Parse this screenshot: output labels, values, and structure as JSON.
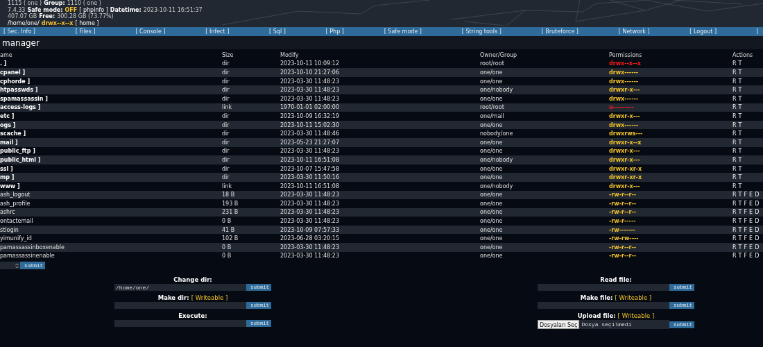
{
  "info": [
    [
      {
        "kind": "text",
        "text": "1115 ( one )"
      },
      {
        "kind": "label",
        "text": "Group:"
      },
      {
        "kind": "text",
        "text": "1110 ( one )"
      }
    ],
    [
      {
        "kind": "text",
        "text": "7.4.33"
      },
      {
        "kind": "label",
        "text": "Safe mode:"
      },
      {
        "kind": "status",
        "text": "OFF"
      },
      {
        "kind": "link",
        "text": "[ phpinfo ]"
      },
      {
        "kind": "label",
        "text": "Datetime:"
      },
      {
        "kind": "text",
        "text": "2023-10-11 16:51:37"
      }
    ],
    [
      {
        "kind": "text",
        "text": "407.07 GB"
      },
      {
        "kind": "label",
        "text": "Free:"
      },
      {
        "kind": "text",
        "text": "300.28 GB (73.77%)"
      }
    ],
    [
      {
        "kind": "link",
        "text": "/home/one/"
      },
      {
        "kind": "status",
        "text": "drwx--x--x"
      },
      {
        "kind": "link",
        "text": "[ home ]"
      }
    ]
  ],
  "menu": [
    "[ Sec. Info ]",
    "[ Files ]",
    "[ Console ]",
    "[ Infect ]",
    "[ Sql ]",
    "[ Php ]",
    "[ Safe mode ]",
    "[ String tools ]",
    "[ Bruteforce ]",
    "[ Network ]",
    "[ Logout ]",
    "["
  ],
  "section_title": "manager",
  "table": {
    "columns": [
      "ame",
      "Size",
      "Modify",
      "Owner/Group",
      "Permissions",
      "Actions"
    ],
    "rows": [
      {
        "kind": "dir",
        "name": ". ]",
        "size": "dir",
        "modify": "2023-10-11 10:09:12",
        "owner": "root/root",
        "perms": "drwx--x--x",
        "writable": false,
        "actions": [
          "R",
          "T"
        ]
      },
      {
        "kind": "dir",
        "name": "cpanel ]",
        "size": "dir",
        "modify": "2023-10-10 21:27:06",
        "owner": "one/one",
        "perms": "drwx------",
        "writable": true,
        "actions": [
          "R",
          "T"
        ]
      },
      {
        "kind": "dir",
        "name": "cphorde ]",
        "size": "dir",
        "modify": "2023-03-30 11:48:23",
        "owner": "one/one",
        "perms": "drwx------",
        "writable": true,
        "actions": [
          "R",
          "T"
        ]
      },
      {
        "kind": "dir",
        "name": "htpasswds ]",
        "size": "dir",
        "modify": "2023-03-30 11:48:23",
        "owner": "one/nobody",
        "perms": "drwxr-x---",
        "writable": true,
        "actions": [
          "R",
          "T"
        ]
      },
      {
        "kind": "dir",
        "name": "spamassassin ]",
        "size": "dir",
        "modify": "2023-03-30 11:48:23",
        "owner": "one/one",
        "perms": "drwx------",
        "writable": true,
        "actions": [
          "R",
          "T"
        ]
      },
      {
        "kind": "dir",
        "name": "access-logs ]",
        "size": "link",
        "modify": "1970-01-01 02:00:00",
        "owner": "root/root",
        "perms": "u---------",
        "writable": false,
        "actions": [
          "R",
          "T"
        ]
      },
      {
        "kind": "dir",
        "name": "etc ]",
        "size": "dir",
        "modify": "2023-10-09 16:32:19",
        "owner": "one/mail",
        "perms": "drwxr-x---",
        "writable": true,
        "actions": [
          "R",
          "T"
        ]
      },
      {
        "kind": "dir",
        "name": "ogs ]",
        "size": "dir",
        "modify": "2023-10-11 15:02:30",
        "owner": "one/one",
        "perms": "drwx------",
        "writable": true,
        "actions": [
          "R",
          "T"
        ]
      },
      {
        "kind": "dir",
        "name": "scache ]",
        "size": "dir",
        "modify": "2023-03-30 11:48:46",
        "owner": "nobody/one",
        "perms": "drwxrws---",
        "writable": true,
        "actions": [
          "R",
          "T"
        ]
      },
      {
        "kind": "dir",
        "name": "mail ]",
        "size": "dir",
        "modify": "2023-05-23 21:27:07",
        "owner": "one/one",
        "perms": "drwxr-x--x",
        "writable": true,
        "actions": [
          "R",
          "T"
        ]
      },
      {
        "kind": "dir",
        "name": "public_ftp ]",
        "size": "dir",
        "modify": "2023-03-30 11:48:23",
        "owner": "one/one",
        "perms": "drwxr-x---",
        "writable": true,
        "actions": [
          "R",
          "T"
        ]
      },
      {
        "kind": "dir",
        "name": "public_html ]",
        "size": "dir",
        "modify": "2023-10-11 16:51:08",
        "owner": "one/nobody",
        "perms": "drwxr-x---",
        "writable": true,
        "actions": [
          "R",
          "T"
        ]
      },
      {
        "kind": "dir",
        "name": "ssl ]",
        "size": "dir",
        "modify": "2023-10-07 15:47:58",
        "owner": "one/one",
        "perms": "drwxr-xr-x",
        "writable": true,
        "actions": [
          "R",
          "T"
        ]
      },
      {
        "kind": "dir",
        "name": "mp ]",
        "size": "dir",
        "modify": "2023-03-30 11:50:16",
        "owner": "one/one",
        "perms": "drwxr-xr-x",
        "writable": true,
        "actions": [
          "R",
          "T"
        ]
      },
      {
        "kind": "dir",
        "name": "www ]",
        "size": "link",
        "modify": "2023-10-11 16:51:08",
        "owner": "one/nobody",
        "perms": "drwxr-x---",
        "writable": true,
        "actions": [
          "R",
          "T"
        ]
      },
      {
        "kind": "file",
        "name": "ash_logout",
        "size": "18 B",
        "modify": "2023-03-30 11:48:23",
        "owner": "one/one",
        "perms": "-rw-r--r--",
        "writable": true,
        "actions": [
          "R",
          "T",
          "F",
          "E",
          "D"
        ]
      },
      {
        "kind": "file",
        "name": "ash_profile",
        "size": "193 B",
        "modify": "2023-03-30 11:48:23",
        "owner": "one/one",
        "perms": "-rw-r--r--",
        "writable": true,
        "actions": [
          "R",
          "T",
          "F",
          "E",
          "D"
        ]
      },
      {
        "kind": "file",
        "name": "ashrc",
        "size": "231 B",
        "modify": "2023-03-30 11:48:23",
        "owner": "one/one",
        "perms": "-rw-r--r--",
        "writable": true,
        "actions": [
          "R",
          "T",
          "F",
          "E",
          "D"
        ]
      },
      {
        "kind": "file",
        "name": "ontactemail",
        "size": "0 B",
        "modify": "2023-03-30 11:48:23",
        "owner": "one/one",
        "perms": "-rw-r-----",
        "writable": true,
        "actions": [
          "R",
          "T",
          "F",
          "E",
          "D"
        ]
      },
      {
        "kind": "file",
        "name": "stlogin",
        "size": "41 B",
        "modify": "2023-10-09 07:57:33",
        "owner": "one/one",
        "perms": "-rw-------",
        "writable": true,
        "actions": [
          "R",
          "T",
          "F",
          "E",
          "D"
        ]
      },
      {
        "kind": "file",
        "name": "yimunify_id",
        "size": "102 B",
        "modify": "2023-06-28 03:20:15",
        "owner": "one/one",
        "perms": "-rw-rw----",
        "writable": true,
        "actions": [
          "R",
          "T",
          "F",
          "E",
          "D"
        ]
      },
      {
        "kind": "file",
        "name": "pamassassinboxenable",
        "size": "0 B",
        "modify": "2023-03-30 11:48:23",
        "owner": "one/one",
        "perms": "-rw-r--r--",
        "writable": true,
        "actions": [
          "R",
          "T",
          "F",
          "E",
          "D"
        ]
      },
      {
        "kind": "file",
        "name": "pamassassinenable",
        "size": "0 B",
        "modify": "2023-03-30 11:48:23",
        "owner": "one/one",
        "perms": "-rw-r--r--",
        "writable": true,
        "actions": [
          "R",
          "T",
          "F",
          "E",
          "D"
        ]
      }
    ]
  },
  "bulk_submit": "submit",
  "forms_left": [
    {
      "kind": "text",
      "label": "Change dir:",
      "value": "/home/one/",
      "button": "submit"
    },
    {
      "kind": "text",
      "label": "Make dir:",
      "note": "[ Writeable ]",
      "button": "submit"
    },
    {
      "kind": "text",
      "label": "Execute:",
      "button": "submit"
    }
  ],
  "forms_right": [
    {
      "kind": "text",
      "label": "Read file:",
      "button": "submit"
    },
    {
      "kind": "text",
      "label": "Make file:",
      "note": "[ Writeable ]",
      "button": "submit"
    },
    {
      "kind": "file",
      "label": "Upload file:",
      "note": "[ Writeable ]",
      "choose": "Dosyaları Seç",
      "status": "Dosya seçilmedi",
      "button": "submit"
    }
  ]
}
